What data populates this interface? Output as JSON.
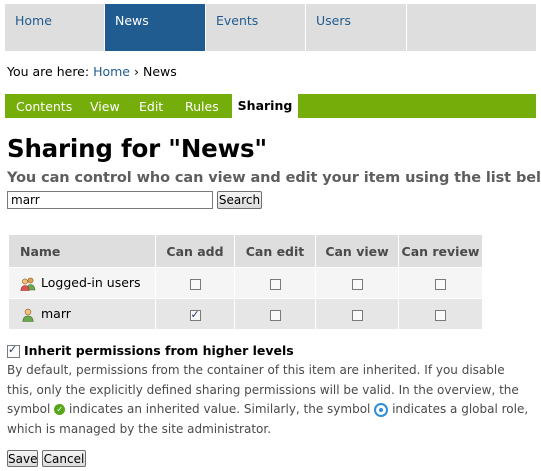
{
  "nav": {
    "tabs": [
      {
        "label": "Home",
        "active": false
      },
      {
        "label": "News",
        "active": true
      },
      {
        "label": "Events",
        "active": false
      },
      {
        "label": "Users",
        "active": false
      }
    ]
  },
  "breadcrumb": {
    "prefix": "You are here:",
    "home": "Home",
    "separator": "›",
    "current": "News"
  },
  "content_tabs": [
    {
      "label": "Contents"
    },
    {
      "label": "View"
    },
    {
      "label": "Edit"
    },
    {
      "label": "Rules"
    },
    {
      "label": "Sharing",
      "active": true
    }
  ],
  "page": {
    "title": "Sharing for \"News\"",
    "subtitle": "You can control who can view and edit your item using the list below."
  },
  "search": {
    "value": "marr",
    "button_label": "Search"
  },
  "table": {
    "headers": [
      "Name",
      "Can add",
      "Can edit",
      "Can view",
      "Can review"
    ],
    "rows": [
      {
        "name": "Logged-in users",
        "icon": "group-users-icon",
        "can_add": false,
        "can_edit": false,
        "can_view": false,
        "can_review": false
      },
      {
        "name": "marr",
        "icon": "user-icon",
        "can_add": true,
        "can_edit": false,
        "can_view": false,
        "can_review": false
      }
    ]
  },
  "inherit": {
    "label": "Inherit permissions from higher levels",
    "checked": true,
    "desc_part1": "By default, permissions from the container of this item are inherited. If you disable this, only the explicitly defined sharing permissions will be valid. In the overview, the symbol",
    "desc_part2": "indicates an inherited value. Similarly, the symbol",
    "desc_part3": "indicates a global role, which is managed by the site administrator."
  },
  "buttons": {
    "save": "Save",
    "cancel": "Cancel"
  },
  "colors": {
    "nav_active": "#205c90",
    "tab_bar": "#75ad0a",
    "link": "#205c90"
  }
}
